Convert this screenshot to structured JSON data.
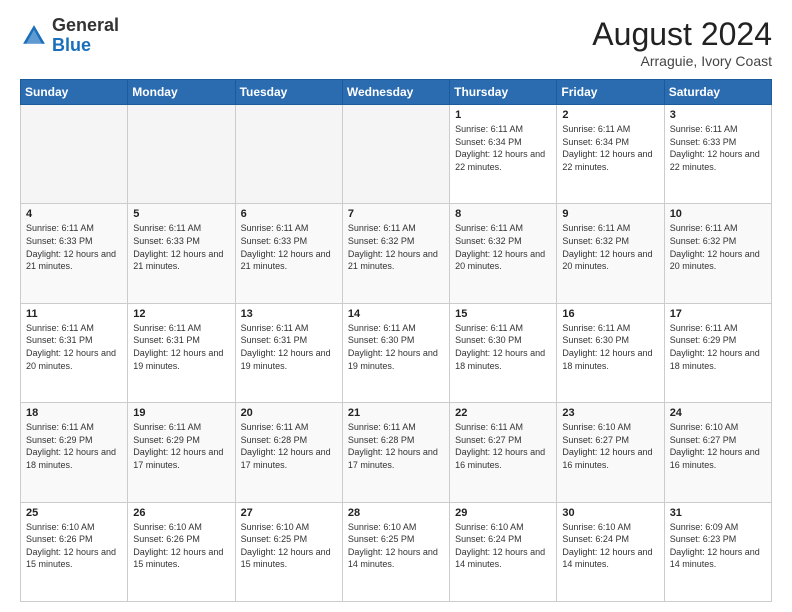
{
  "header": {
    "logo_general": "General",
    "logo_blue": "Blue",
    "title": "August 2024",
    "subtitle": "Arraguie, Ivory Coast"
  },
  "calendar": {
    "days_of_week": [
      "Sunday",
      "Monday",
      "Tuesday",
      "Wednesday",
      "Thursday",
      "Friday",
      "Saturday"
    ],
    "weeks": [
      [
        {
          "day": "",
          "empty": true
        },
        {
          "day": "",
          "empty": true
        },
        {
          "day": "",
          "empty": true
        },
        {
          "day": "",
          "empty": true
        },
        {
          "day": "1",
          "sunrise": "6:11 AM",
          "sunset": "6:34 PM",
          "daylight": "12 hours and 22 minutes."
        },
        {
          "day": "2",
          "sunrise": "6:11 AM",
          "sunset": "6:34 PM",
          "daylight": "12 hours and 22 minutes."
        },
        {
          "day": "3",
          "sunrise": "6:11 AM",
          "sunset": "6:33 PM",
          "daylight": "12 hours and 22 minutes."
        }
      ],
      [
        {
          "day": "4",
          "sunrise": "6:11 AM",
          "sunset": "6:33 PM",
          "daylight": "12 hours and 21 minutes."
        },
        {
          "day": "5",
          "sunrise": "6:11 AM",
          "sunset": "6:33 PM",
          "daylight": "12 hours and 21 minutes."
        },
        {
          "day": "6",
          "sunrise": "6:11 AM",
          "sunset": "6:33 PM",
          "daylight": "12 hours and 21 minutes."
        },
        {
          "day": "7",
          "sunrise": "6:11 AM",
          "sunset": "6:32 PM",
          "daylight": "12 hours and 21 minutes."
        },
        {
          "day": "8",
          "sunrise": "6:11 AM",
          "sunset": "6:32 PM",
          "daylight": "12 hours and 20 minutes."
        },
        {
          "day": "9",
          "sunrise": "6:11 AM",
          "sunset": "6:32 PM",
          "daylight": "12 hours and 20 minutes."
        },
        {
          "day": "10",
          "sunrise": "6:11 AM",
          "sunset": "6:32 PM",
          "daylight": "12 hours and 20 minutes."
        }
      ],
      [
        {
          "day": "11",
          "sunrise": "6:11 AM",
          "sunset": "6:31 PM",
          "daylight": "12 hours and 20 minutes."
        },
        {
          "day": "12",
          "sunrise": "6:11 AM",
          "sunset": "6:31 PM",
          "daylight": "12 hours and 19 minutes."
        },
        {
          "day": "13",
          "sunrise": "6:11 AM",
          "sunset": "6:31 PM",
          "daylight": "12 hours and 19 minutes."
        },
        {
          "day": "14",
          "sunrise": "6:11 AM",
          "sunset": "6:30 PM",
          "daylight": "12 hours and 19 minutes."
        },
        {
          "day": "15",
          "sunrise": "6:11 AM",
          "sunset": "6:30 PM",
          "daylight": "12 hours and 18 minutes."
        },
        {
          "day": "16",
          "sunrise": "6:11 AM",
          "sunset": "6:30 PM",
          "daylight": "12 hours and 18 minutes."
        },
        {
          "day": "17",
          "sunrise": "6:11 AM",
          "sunset": "6:29 PM",
          "daylight": "12 hours and 18 minutes."
        }
      ],
      [
        {
          "day": "18",
          "sunrise": "6:11 AM",
          "sunset": "6:29 PM",
          "daylight": "12 hours and 18 minutes."
        },
        {
          "day": "19",
          "sunrise": "6:11 AM",
          "sunset": "6:29 PM",
          "daylight": "12 hours and 17 minutes."
        },
        {
          "day": "20",
          "sunrise": "6:11 AM",
          "sunset": "6:28 PM",
          "daylight": "12 hours and 17 minutes."
        },
        {
          "day": "21",
          "sunrise": "6:11 AM",
          "sunset": "6:28 PM",
          "daylight": "12 hours and 17 minutes."
        },
        {
          "day": "22",
          "sunrise": "6:11 AM",
          "sunset": "6:27 PM",
          "daylight": "12 hours and 16 minutes."
        },
        {
          "day": "23",
          "sunrise": "6:10 AM",
          "sunset": "6:27 PM",
          "daylight": "12 hours and 16 minutes."
        },
        {
          "day": "24",
          "sunrise": "6:10 AM",
          "sunset": "6:27 PM",
          "daylight": "12 hours and 16 minutes."
        }
      ],
      [
        {
          "day": "25",
          "sunrise": "6:10 AM",
          "sunset": "6:26 PM",
          "daylight": "12 hours and 15 minutes."
        },
        {
          "day": "26",
          "sunrise": "6:10 AM",
          "sunset": "6:26 PM",
          "daylight": "12 hours and 15 minutes."
        },
        {
          "day": "27",
          "sunrise": "6:10 AM",
          "sunset": "6:25 PM",
          "daylight": "12 hours and 15 minutes."
        },
        {
          "day": "28",
          "sunrise": "6:10 AM",
          "sunset": "6:25 PM",
          "daylight": "12 hours and 14 minutes."
        },
        {
          "day": "29",
          "sunrise": "6:10 AM",
          "sunset": "6:24 PM",
          "daylight": "12 hours and 14 minutes."
        },
        {
          "day": "30",
          "sunrise": "6:10 AM",
          "sunset": "6:24 PM",
          "daylight": "12 hours and 14 minutes."
        },
        {
          "day": "31",
          "sunrise": "6:09 AM",
          "sunset": "6:23 PM",
          "daylight": "12 hours and 14 minutes."
        }
      ]
    ],
    "labels": {
      "sunrise": "Sunrise:",
      "sunset": "Sunset:",
      "daylight": "Daylight hours"
    }
  }
}
